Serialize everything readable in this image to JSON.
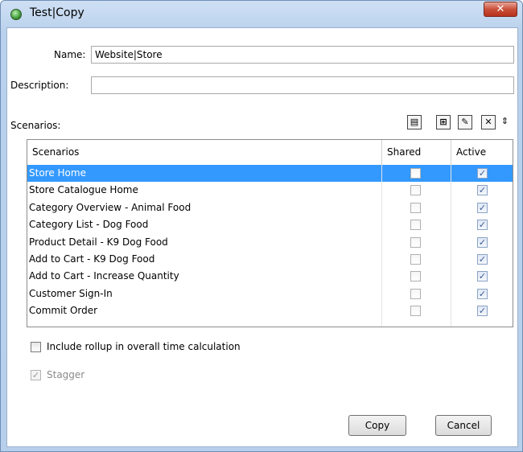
{
  "window": {
    "title": "Test|Copy",
    "close_glyph": "✕"
  },
  "form": {
    "name_label": "Name:",
    "name_value": "Website|Store",
    "description_label": "Description:",
    "description_value": "",
    "scenarios_label": "Scenarios:"
  },
  "toolbar": {
    "icons": [
      "new-scenario-icon",
      "add-icon",
      "edit-icon",
      "delete-icon",
      "reorder-icon"
    ],
    "glyphs": [
      "▤",
      "⊞",
      "✎",
      "✕",
      "⇕"
    ]
  },
  "table": {
    "columns": [
      "Scenarios",
      "Shared",
      "Active"
    ],
    "rows": [
      {
        "name": "Store Home",
        "shared": false,
        "active": true,
        "selected": true
      },
      {
        "name": "Store Catalogue Home",
        "shared": false,
        "active": true,
        "selected": false
      },
      {
        "name": "Category Overview - Animal Food",
        "shared": false,
        "active": true,
        "selected": false
      },
      {
        "name": "Category List - Dog Food",
        "shared": false,
        "active": true,
        "selected": false
      },
      {
        "name": "Product Detail - K9 Dog Food",
        "shared": false,
        "active": true,
        "selected": false
      },
      {
        "name": "Add to Cart - K9 Dog Food",
        "shared": false,
        "active": true,
        "selected": false
      },
      {
        "name": "Add to Cart - Increase Quantity",
        "shared": false,
        "active": true,
        "selected": false
      },
      {
        "name": "Customer Sign-In",
        "shared": false,
        "active": true,
        "selected": false
      },
      {
        "name": "Commit Order",
        "shared": false,
        "active": true,
        "selected": false
      }
    ]
  },
  "options": {
    "rollup_label": "Include rollup in overall time calculation",
    "rollup_checked": false,
    "stagger_label": "Stagger",
    "stagger_checked": true,
    "stagger_enabled": false
  },
  "buttons": {
    "copy": "Copy",
    "cancel": "Cancel"
  },
  "colors": {
    "selection": "#3399ff",
    "title_bar": "#b9d1ec",
    "close_button": "#c9503a"
  }
}
